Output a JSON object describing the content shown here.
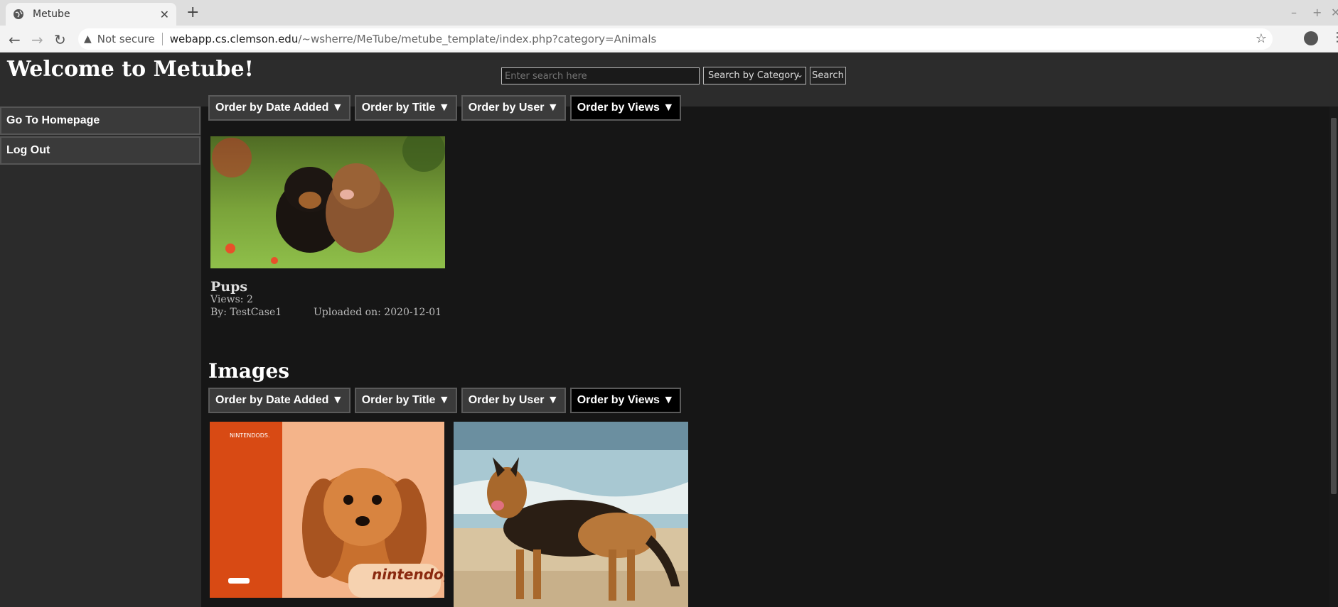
{
  "browser": {
    "tab_title": "Metube",
    "new_tab": "+",
    "security_label": "Not secure",
    "url_host": "webapp.cs.clemson.edu",
    "url_path": "/~wsherre/MeTube/metube_template/index.php?category=Animals"
  },
  "site": {
    "title": "Welcome to Metube!"
  },
  "search": {
    "placeholder": "Enter search here",
    "category_selected": "Search by Category",
    "button_label": "Search"
  },
  "sidebar": {
    "items": [
      {
        "label": "Go To Homepage"
      },
      {
        "label": "Log Out"
      }
    ]
  },
  "order_buttons": [
    {
      "label": "Order by Date Added ▼"
    },
    {
      "label": "Order by Title ▼"
    },
    {
      "label": "Order by User ▼"
    },
    {
      "label": "Order by Views ▼"
    }
  ],
  "videos": {
    "items": [
      {
        "title": "Pups",
        "views": "Views: 2",
        "by": "By: TestCase1",
        "uploaded": "Uploaded on: 2020-12-01"
      }
    ]
  },
  "images": {
    "heading": "Images",
    "thumb1_brand": "NINTENDODS.",
    "thumb1_logo": "nintendogs"
  }
}
